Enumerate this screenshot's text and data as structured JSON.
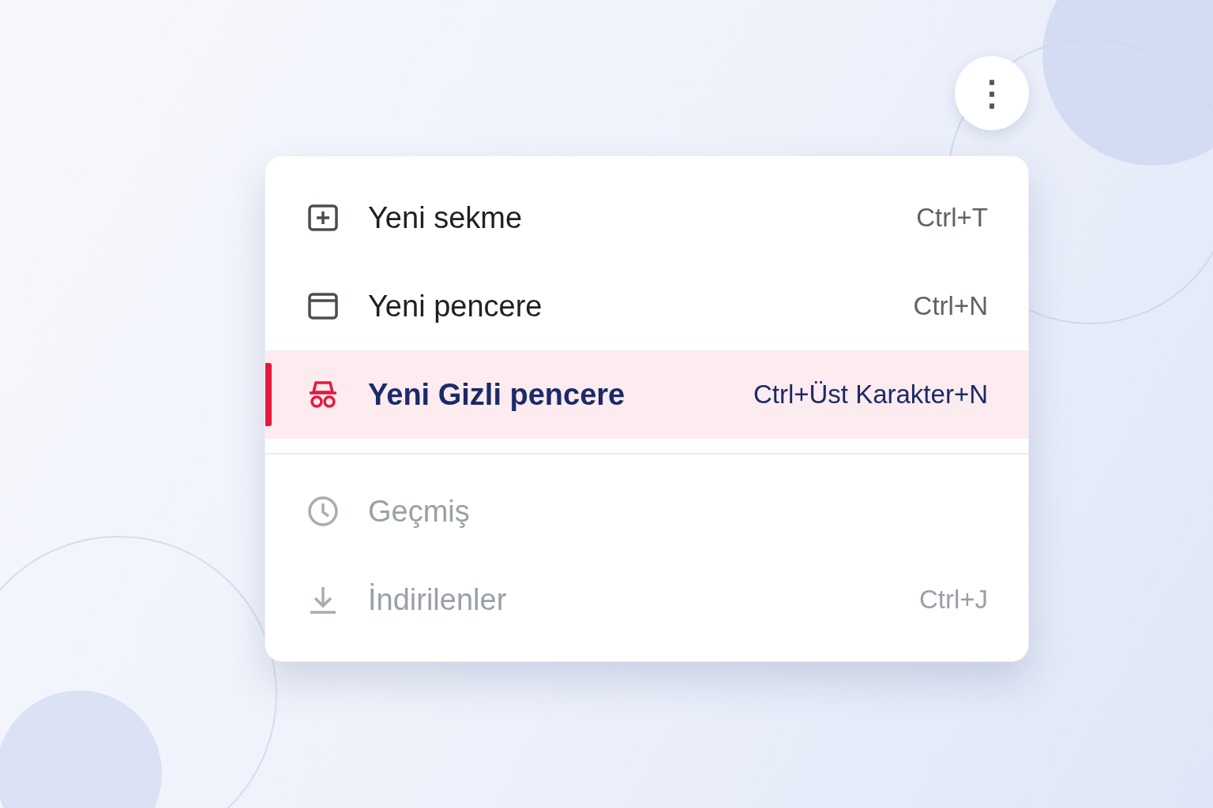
{
  "menu_button": {
    "label": "⋮"
  },
  "menu": {
    "sections": [
      [
        {
          "label": "Yeni sekme",
          "shortcut": "Ctrl+T",
          "selected": false,
          "disabled": false
        },
        {
          "label": "Yeni pencere",
          "shortcut": "Ctrl+N",
          "selected": false,
          "disabled": false
        },
        {
          "label": "Yeni Gizli pencere",
          "shortcut": "Ctrl+Üst Karakter+N",
          "selected": true,
          "disabled": false
        }
      ],
      [
        {
          "label": "Geçmiş",
          "selected": false,
          "disabled": true
        },
        {
          "label": "İndirilenler",
          "shortcut": "Ctrl+J",
          "selected": false,
          "disabled": true
        }
      ]
    ]
  }
}
